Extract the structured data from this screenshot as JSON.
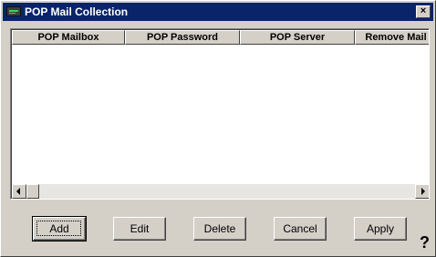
{
  "window": {
    "title": "POP Mail Collection",
    "icon": "mail-app-icon",
    "close_label": "×"
  },
  "listview": {
    "columns": [
      "POP Mailbox",
      "POP Password",
      "POP Server",
      "Remove Mail"
    ],
    "rows": []
  },
  "buttons": {
    "add": "Add",
    "edit": "Edit",
    "delete": "Delete",
    "cancel": "Cancel",
    "apply": "Apply"
  },
  "help": {
    "label": "?"
  },
  "colors": {
    "titlebar": "#0a246a",
    "face": "#d4d0c8"
  }
}
